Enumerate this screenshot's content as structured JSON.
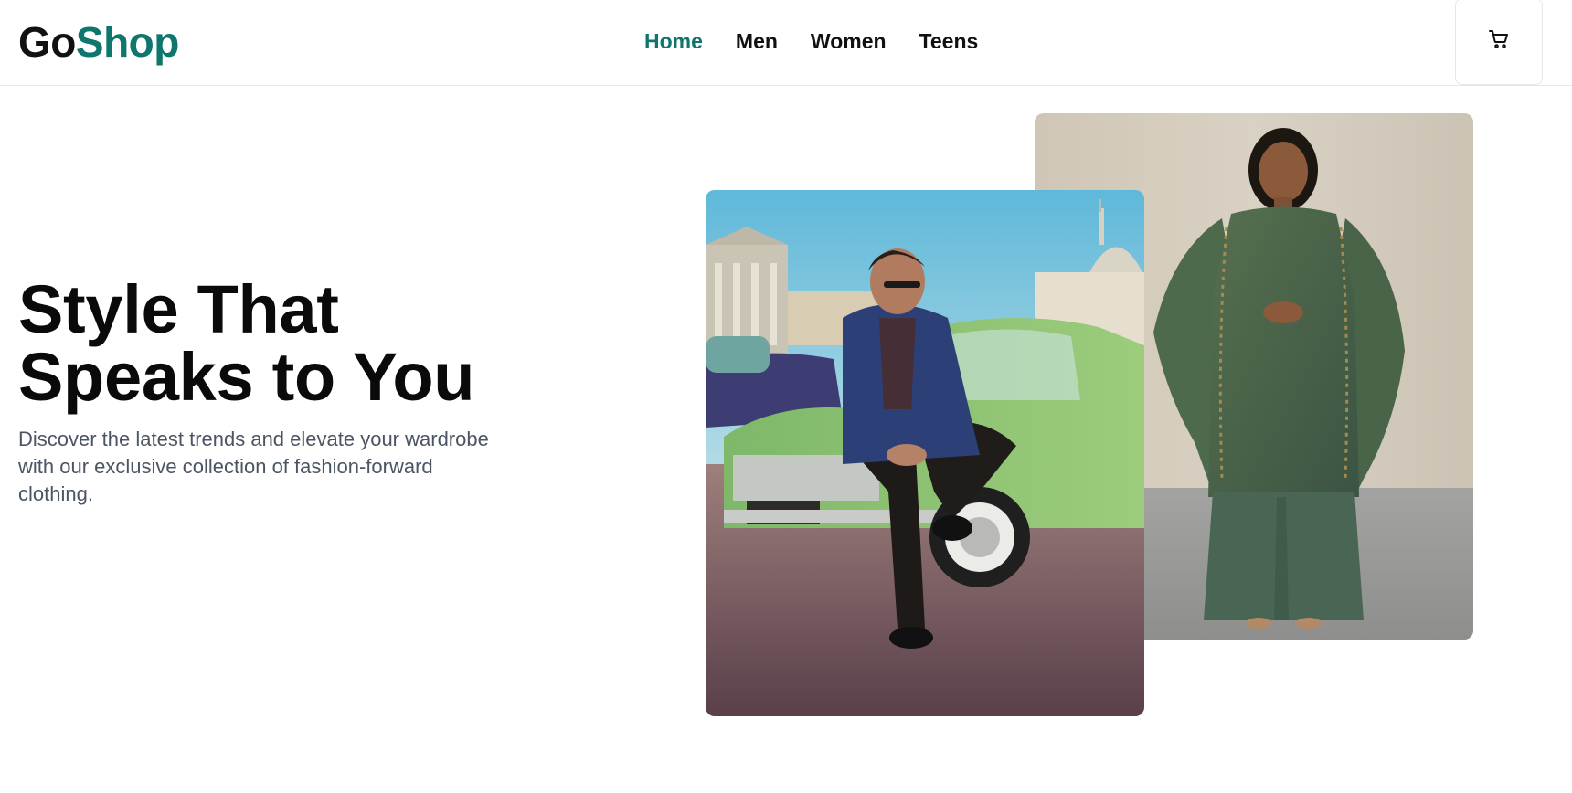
{
  "brand": {
    "part1": "Go",
    "part2": "Shop"
  },
  "nav": [
    {
      "label": "Home",
      "active": true
    },
    {
      "label": "Men",
      "active": false
    },
    {
      "label": "Women",
      "active": false
    },
    {
      "label": "Teens",
      "active": false
    }
  ],
  "cart": {
    "icon": "cart-icon"
  },
  "hero": {
    "title_line1": "Style That",
    "title_line2": "Speaks to You",
    "description": "Discover the latest trends and elevate your wardrobe with our exclusive collection of fashion-forward clothing."
  },
  "colors": {
    "accent": "#0f766e",
    "text": "#111111",
    "muted": "#4b5563",
    "border": "#e5e7eb"
  },
  "images": [
    {
      "name": "hero-image-men",
      "subject": "man in navy jacket sitting on green vintage car"
    },
    {
      "name": "hero-image-women",
      "subject": "woman in green embroidered kurta set with dupatta"
    }
  ]
}
